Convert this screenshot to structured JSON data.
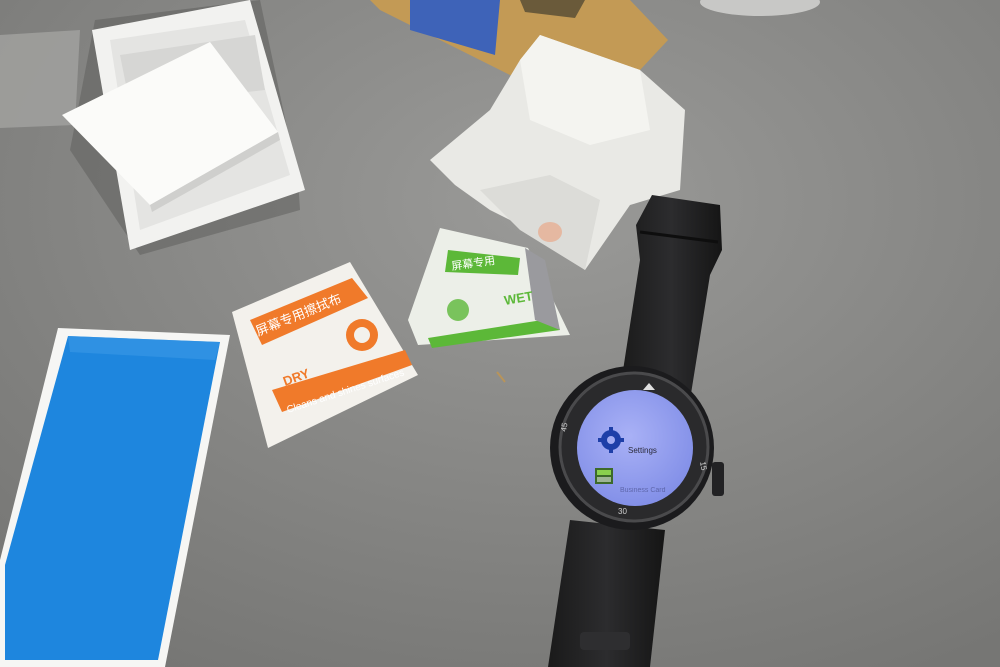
{
  "dry_wipe": {
    "chinese_text": "屏幕专用擦拭布",
    "label": "DRY",
    "tagline": "Cleans and shines surfaces",
    "accent_color": "#f07a2a"
  },
  "wet_wipe": {
    "chinese_text": "屏幕专用",
    "label": "WET",
    "accent_color": "#5cb838"
  },
  "watch_screen": {
    "items": [
      {
        "label": "Settings",
        "icon": "gear-icon"
      },
      {
        "label": "Business Card",
        "icon": "card-icon"
      }
    ],
    "screen_color": "#9aa4f0"
  },
  "watch_bezel": {
    "numerals": [
      "45",
      "15",
      "30"
    ]
  },
  "colors": {
    "table": "#8c8c8a",
    "blue_film": "#1f88e0",
    "watch_body": "#1b1b1d"
  }
}
